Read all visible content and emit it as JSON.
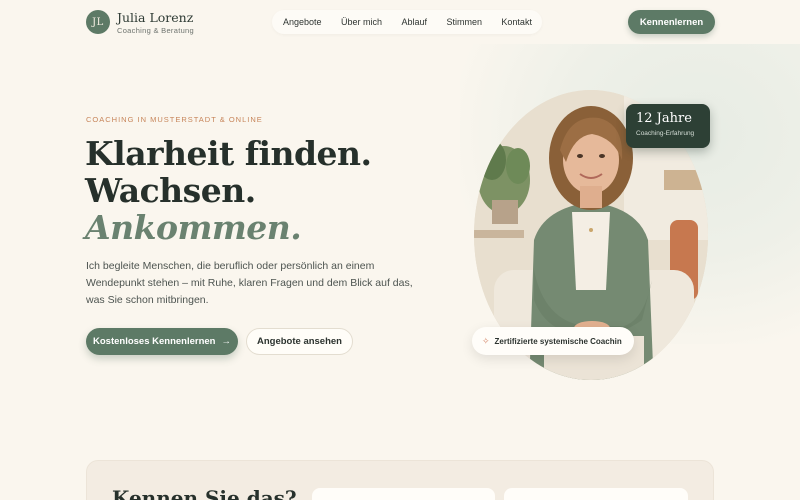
{
  "brand": {
    "initials": "JL",
    "name": "Julia Lorenz",
    "tagline": "Coaching & Beratung"
  },
  "nav": {
    "items": [
      {
        "label": "Angebote"
      },
      {
        "label": "Über mich"
      },
      {
        "label": "Ablauf"
      },
      {
        "label": "Stimmen"
      },
      {
        "label": "Kontakt"
      }
    ]
  },
  "header": {
    "cta_label": "Kennenlernen"
  },
  "hero": {
    "eyebrow": "COACHING IN MUSTERSTADT & ONLINE",
    "title_line1": "Klarheit finden.",
    "title_line2": "Wachsen.",
    "title_line3": "Ankommen.",
    "lead": "Ich begleite Menschen, die beruflich oder persönlich an einem Wendepunkt stehen – mit Ruhe, klaren Fragen und dem Blick auf das, was Sie schon mitbringen.",
    "primary_cta": "Kostenloses Kennenlernen",
    "primary_cta_icon": "→",
    "secondary_cta": "Angebote ansehen"
  },
  "badges": {
    "years_value": "12 Jahre",
    "years_label": "Coaching-Erfahrung",
    "cert_label": "Zertifizierte systemische Coachin",
    "cert_icon": "sparkle-icon"
  },
  "section2": {
    "title": "Kennen Sie das?"
  },
  "colors": {
    "background": "#faf6ee",
    "primary": "#5d7a66",
    "dark_green": "#2d4035",
    "accent": "#c7855a"
  }
}
